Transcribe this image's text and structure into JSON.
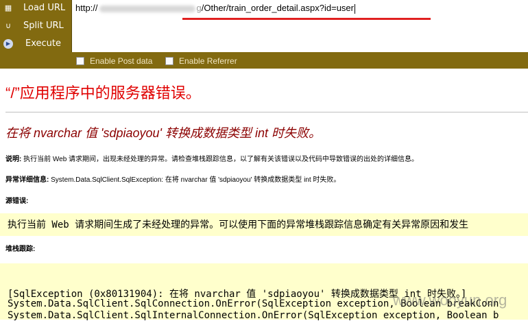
{
  "toolbar": {
    "load_url": "Load URL",
    "split_url": "Split URL",
    "execute": "Execute",
    "url_prefix": "http://",
    "url_suffix": "/Other/train_order_detail.aspx?id=user",
    "url_redacted_fragment": "g",
    "enable_post": "Enable Post data",
    "enable_referrer": "Enable Referrer"
  },
  "error_page": {
    "title": "“/”应用程序中的服务器错误。",
    "subtitle": "在将 nvarchar 值 'sdpiaoyou' 转换成数据类型 int 时失败。",
    "desc_label": "说明:",
    "desc_text": " 执行当前 Web 请求期间，出现未经处理的异常。请检查堆栈跟踪信息，以了解有关该错误以及代码中导致错误的出处的详细信息。",
    "exception_label": "异常详细信息:",
    "exception_text": " System.Data.SqlClient.SqlException: 在将 nvarchar 值 'sdpiaoyou' 转换成数据类型 int 时失败。",
    "source_label": "源错误:",
    "source_text": "执行当前 Web 请求期间生成了未经处理的异常。可以使用下面的异常堆栈跟踪信息确定有关异常原因和发生",
    "stack_label": "堆栈跟踪:",
    "stack_lines": [
      "[SqlException (0x80131904): 在将 nvarchar 值 'sdpiaoyou' 转换成数据类型 int 时失败。]",
      "   System.Data.SqlClient.SqlConnection.OnError(SqlException exception, Boolean breakConn",
      "   System.Data.SqlClient.SqlInternalConnection.OnError(SqlException exception, Boolean b"
    ]
  },
  "watermark": "www.wooyun.org",
  "colors": {
    "toolbar_bg": "#826a10",
    "title_red": "#e00000",
    "subtitle_darkred": "#8b0000",
    "highlight_bg": "#ffffcc",
    "annotation_red": "#e02020"
  }
}
